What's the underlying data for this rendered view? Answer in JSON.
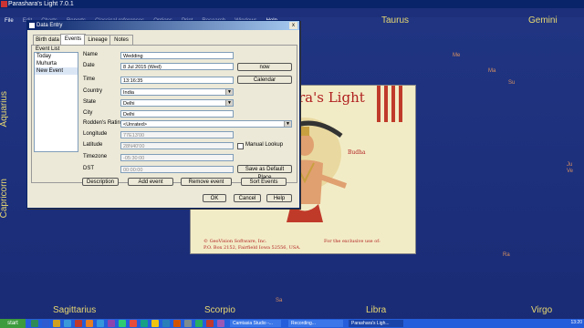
{
  "window": {
    "title": "Parashara's Light 7.0.1"
  },
  "menu": [
    {
      "label": "File",
      "enabled": true
    },
    {
      "label": "Edit",
      "enabled": false
    },
    {
      "label": "Charts",
      "enabled": false
    },
    {
      "label": "Reports",
      "enabled": false
    },
    {
      "label": "Classical references",
      "enabled": false
    },
    {
      "label": "Options",
      "enabled": false
    },
    {
      "label": "Print",
      "enabled": false
    },
    {
      "label": "Research",
      "enabled": false
    },
    {
      "label": "Windows",
      "enabled": false
    },
    {
      "label": "Help",
      "enabled": true
    }
  ],
  "zodiac": {
    "taurus": "Taurus",
    "gemini": "Gemini",
    "aquarius": "Aquarius",
    "capricorn": "Capricorn",
    "sagittarius": "Sagittarius",
    "scorpio": "Scorpio",
    "libra": "Libra",
    "virgo": "Virgo"
  },
  "planets": {
    "me": "Me",
    "ma": "Ma",
    "su": "Su",
    "ju": "Ju",
    "ve": "Ve",
    "ra": "Ra",
    "sa": "Sa"
  },
  "splash": {
    "brand": "ra's Light",
    "budha": "Budha",
    "copyright_line1": "© GeoVision Software, Inc.",
    "copyright_line2": "P.O. Box 2152, Fairfield  Iowa 52556, USA.",
    "exclusive": "For the exclusive use of:"
  },
  "dialog": {
    "title": "Data Entry",
    "close": "x",
    "tabs": [
      "Birth data",
      "Events",
      "Lineage",
      "Notes"
    ],
    "active_tab": "Events",
    "event_list_label": "Event List",
    "events": [
      "Today",
      "Muhurta",
      "New Event"
    ],
    "selected_event": "New Event",
    "fields": {
      "name_label": "Name",
      "name": "Wedding",
      "date_label": "Date",
      "date": "8 Jul 2015  (Wed)",
      "time_label": "Time",
      "time": "13:16:35",
      "country_label": "Country",
      "country": "India",
      "state_label": "State",
      "state": "Delhi",
      "city_label": "City",
      "city": "Delhi",
      "rodden_label": "Rodden's Rating",
      "rodden": "<Unrated>",
      "longitude_label": "Longitude",
      "longitude": "77E13'00",
      "latitude_label": "Latitude",
      "latitude": "28N40'00",
      "timezone_label": "Timezone",
      "timezone": "-05:30:00",
      "dst_label": "DST",
      "dst": "00:00:00"
    },
    "manual_lookup": "Manual Lookup",
    "buttons": {
      "now": "now",
      "calendar": "Calendar",
      "save_default": "Save as Default Place",
      "description": "Description",
      "add_event": "Add event",
      "remove_event": "Remove event",
      "sort_events": "Sort Events",
      "ok": "OK",
      "cancel": "Cancel",
      "help": "Help"
    }
  },
  "taskbar": {
    "start": "start",
    "tasks": [
      "Camtasia Studio -...",
      "Recording...",
      "Parashara's Ligh..."
    ],
    "clock": "13:20"
  },
  "colors": {
    "sky": "#1d2f7a",
    "zodiac_text": "#e8d870",
    "planet_text": "#d89060",
    "splash_red": "#b02020"
  }
}
